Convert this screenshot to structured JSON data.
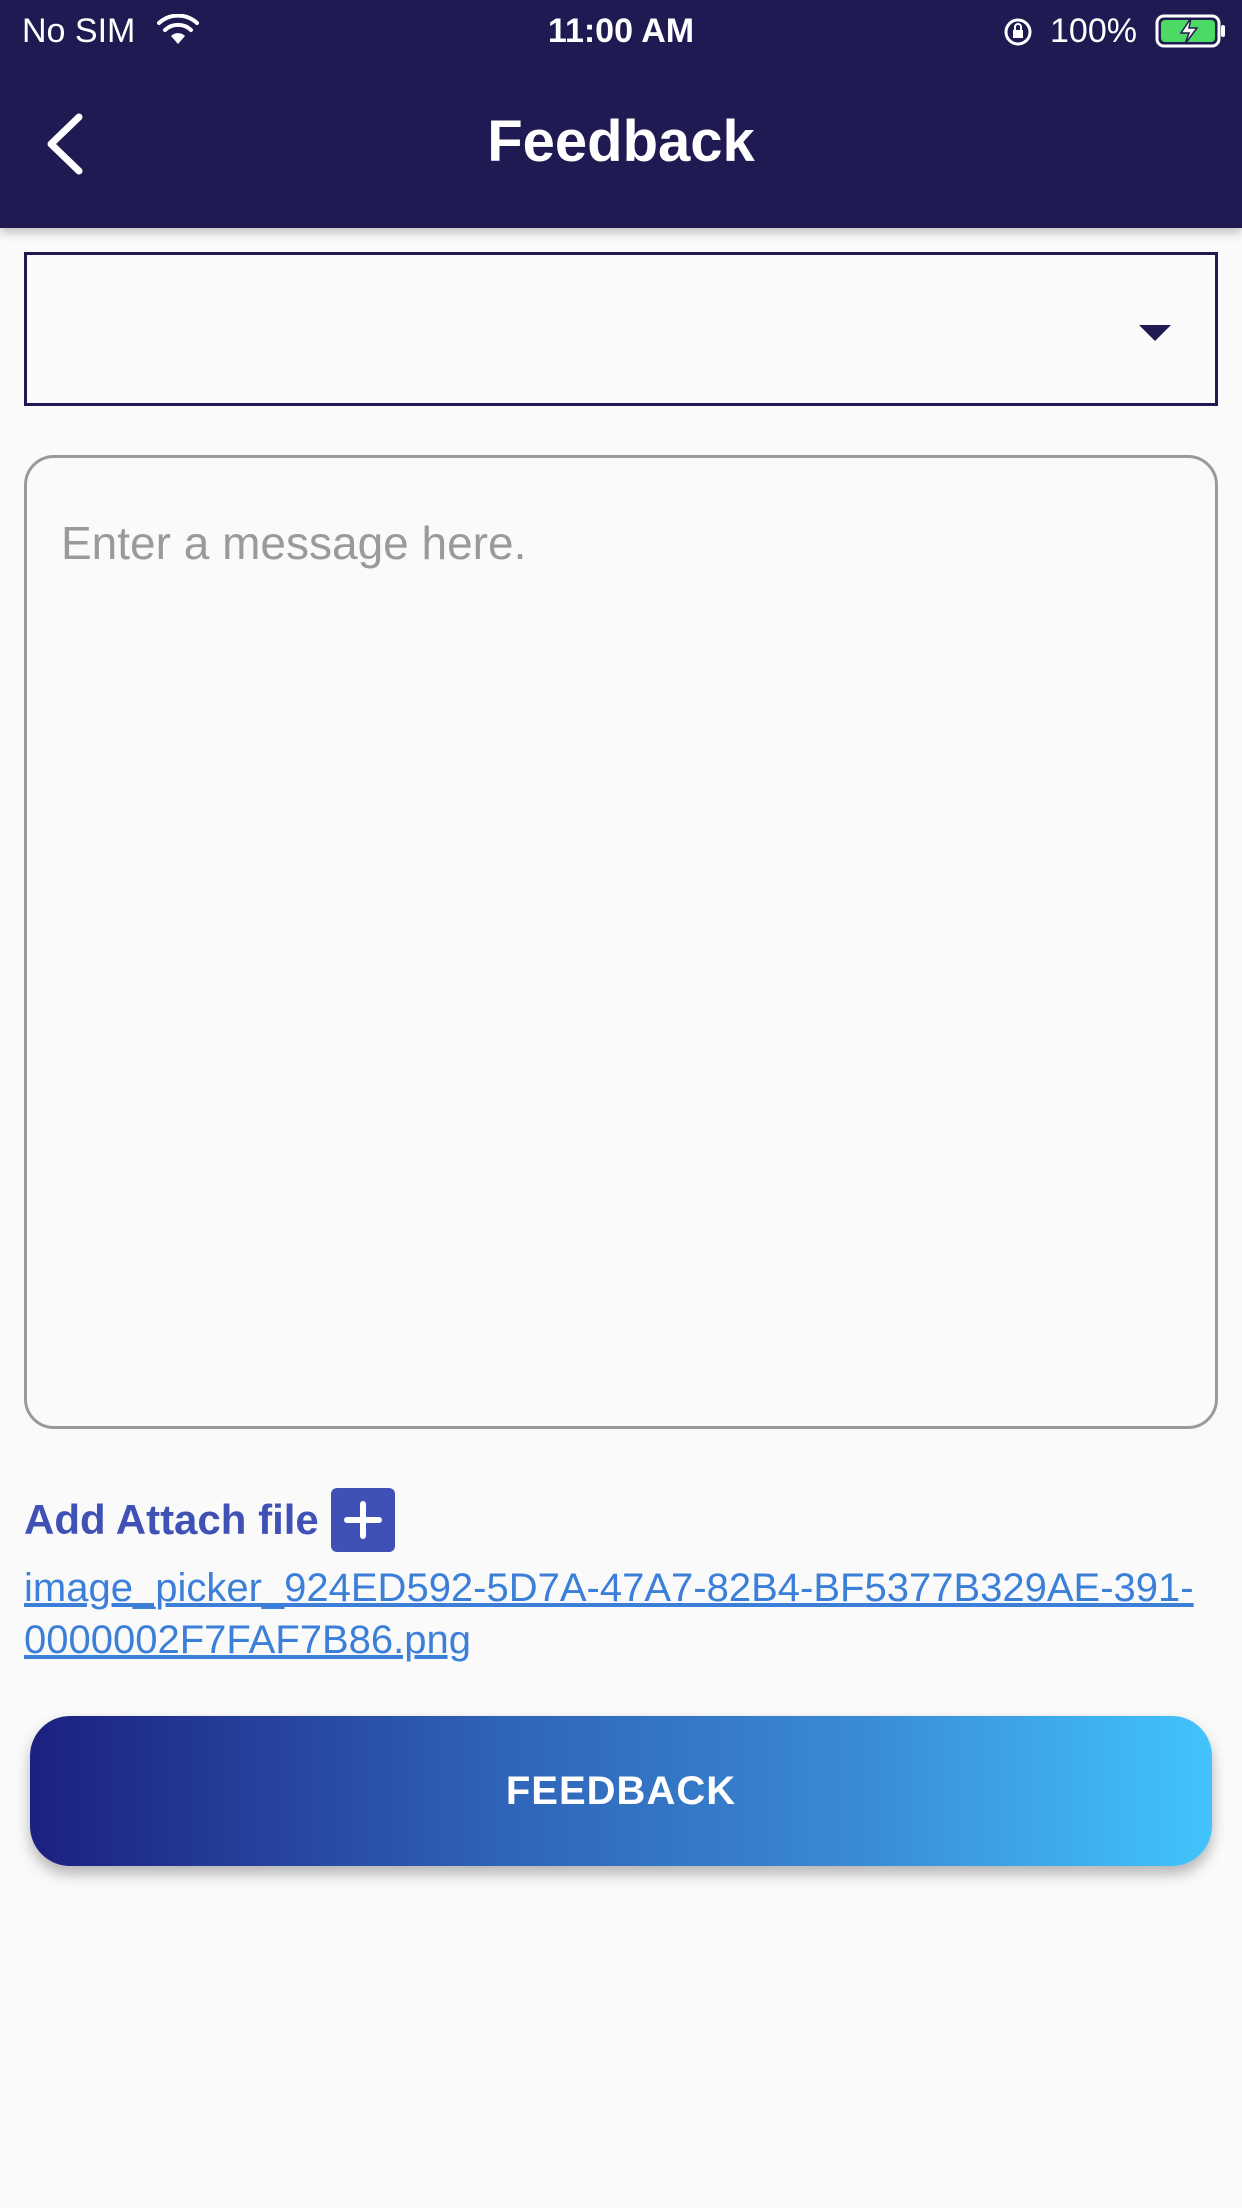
{
  "status_bar": {
    "carrier": "No SIM",
    "time": "11:00 AM",
    "battery_percent": "100%"
  },
  "app_bar": {
    "title": "Feedback",
    "back_icon": "chevron-left-icon",
    "background_color": "#1f1b52"
  },
  "category_dropdown": {
    "selected_value": "",
    "icon": "triangle-down-icon"
  },
  "message": {
    "value": "",
    "placeholder": "Enter a message here."
  },
  "attachment": {
    "label": "Add Attach file",
    "add_icon": "plus-icon",
    "filename": "image_picker_924ED592-5D7A-47A7-82B4-BF5377B329AE-391-0000002F7FAF7B86.png"
  },
  "submit": {
    "label": "FEEDBACK"
  },
  "colors": {
    "accent": "#3f51b5",
    "link": "#3b7fd9",
    "gradient_start": "#1c2080",
    "gradient_end": "#41c4fb"
  }
}
